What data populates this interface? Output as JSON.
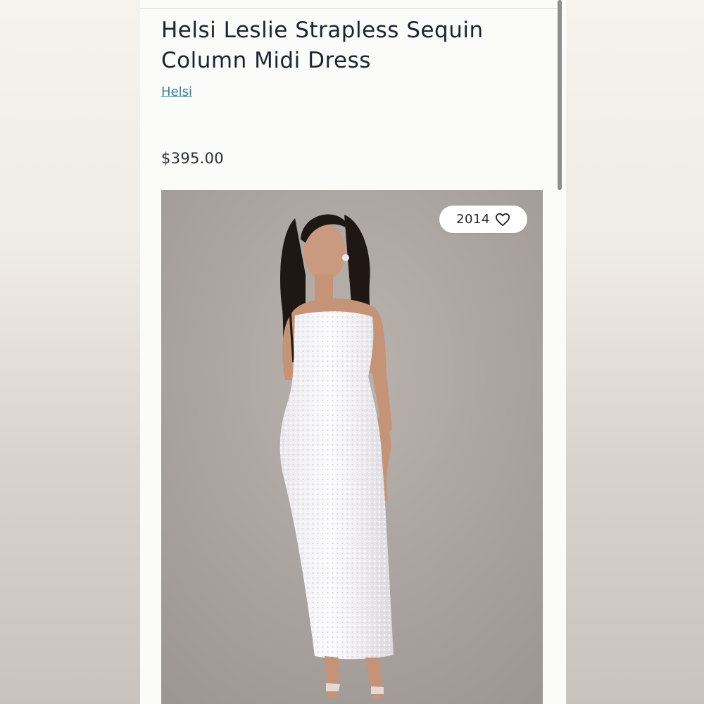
{
  "product": {
    "title": "Helsi Leslie Strapless Sequin Column Midi Dress",
    "brand": "Helsi",
    "price": "$395.00"
  },
  "image": {
    "like_count": "2014",
    "like_icon": "heart-outline-icon"
  },
  "colors": {
    "title": "#1d2431",
    "brand_link": "#3e8194",
    "background": "#fbfbf9"
  }
}
